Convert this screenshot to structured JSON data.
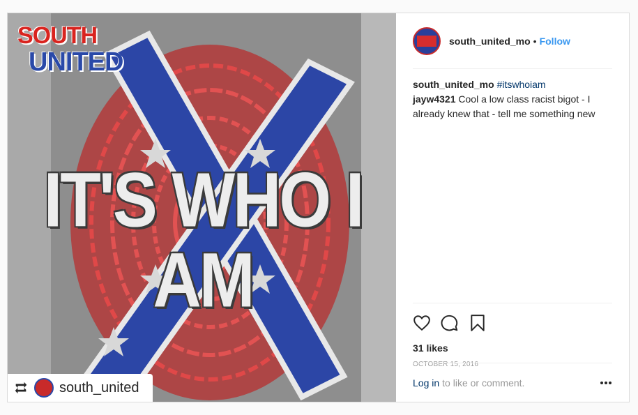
{
  "image": {
    "brand_top": "SOUTH",
    "brand_bottom": "UNITED",
    "headline": "IT'S WHO I AM",
    "repost_user": "south_united"
  },
  "header": {
    "username": "south_united_mo",
    "separator": "•",
    "follow_label": "Follow"
  },
  "comments": [
    {
      "user": "south_united_mo",
      "text": "#itswhoiam"
    },
    {
      "user": "jayw4321",
      "text": "Cool a low class racist bigot - I already knew that - tell me something new"
    }
  ],
  "likes": "31 likes",
  "date": "OCTOBER 15, 2016",
  "add_comment": {
    "login_label": "Log in",
    "rest": "to like or comment."
  },
  "icons": [
    "heart-icon",
    "comment-icon",
    "bookmark-icon",
    "more-options-icon",
    "repost-icon"
  ],
  "colors": {
    "follow": "#3897f0",
    "brand_red": "#d9241f",
    "brand_blue": "#2a49a8"
  }
}
